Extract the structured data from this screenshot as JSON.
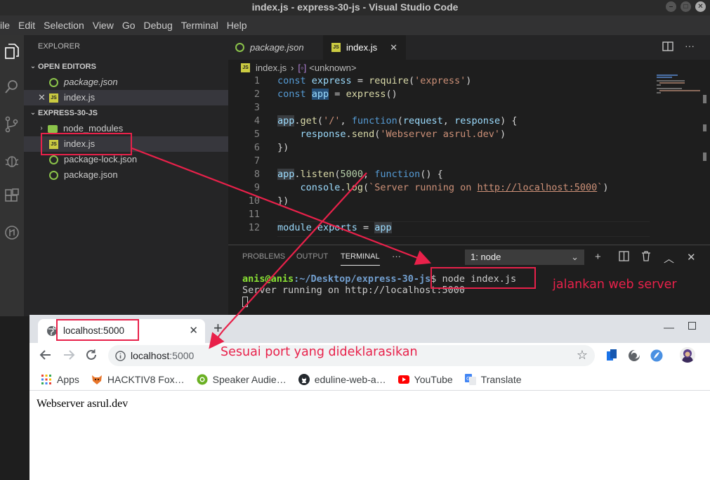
{
  "window": {
    "title": "index.js - express-30-js - Visual Studio Code"
  },
  "menu": [
    "ile",
    "Edit",
    "Selection",
    "View",
    "Go",
    "Debug",
    "Terminal",
    "Help"
  ],
  "sidebar": {
    "title": "EXPLORER",
    "open_editors_label": "OPEN EDITORS",
    "open_editors": [
      {
        "name": "package.json",
        "italic": true
      },
      {
        "name": "index.js"
      }
    ],
    "project_label": "EXPRESS-30-JS",
    "files": [
      {
        "name": "node_modules",
        "kind": "folder"
      },
      {
        "name": "index.js",
        "kind": "js"
      },
      {
        "name": "package-lock.json",
        "kind": "json"
      },
      {
        "name": "package.json",
        "kind": "json"
      }
    ]
  },
  "editor": {
    "tabs": [
      {
        "label": "package.json",
        "italic": true
      },
      {
        "label": "index.js",
        "active": true
      }
    ],
    "breadcrumb": {
      "file": "index.js",
      "symbol": "<unknown>"
    },
    "lines": [
      "1",
      "2",
      "3",
      "4",
      "5",
      "6",
      "7",
      "8",
      "9",
      "10",
      "11",
      "12"
    ]
  },
  "panel": {
    "tabs": [
      "PROBLEMS",
      "OUTPUT",
      "TERMINAL",
      "···"
    ],
    "terminal_select": "1: node",
    "prompt_user": "anis@anis",
    "prompt_path": ":~/Desktop/express-30-js",
    "prompt_command": "$ node index.js",
    "output": "Server running on http://localhost:5000"
  },
  "browser": {
    "tab_title": "localhost:5000",
    "url_host": "localhost",
    "url_port": ":5000",
    "bookmarks": [
      "Apps",
      "HACKTIV8 Fox…",
      "Speaker Audie…",
      "eduline-web-a…",
      "YouTube",
      "Translate"
    ],
    "page_text": "Webserver asrul.dev"
  },
  "annotations": {
    "terminal_note": "jalankan web server",
    "port_note": "Sesuai port yang dideklarasikan",
    "color": "#e8214a"
  }
}
